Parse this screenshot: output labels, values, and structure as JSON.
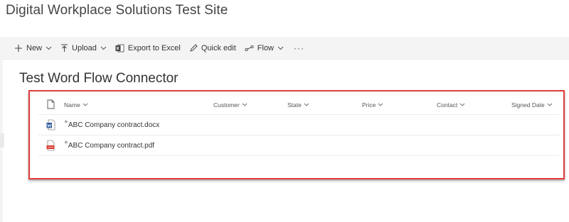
{
  "site": {
    "title": "Digital Workplace Solutions Test Site"
  },
  "commandbar": {
    "new_label": "New",
    "upload_label": "Upload",
    "export_label": "Export to Excel",
    "quickedit_label": "Quick edit",
    "flow_label": "Flow",
    "more_label": "···"
  },
  "list": {
    "title": "Test Word Flow Connector",
    "columns": {
      "name": "Name",
      "customer": "Customer",
      "state": "State",
      "price": "Price",
      "contact": "Contact",
      "signed_date": "Signed Date"
    },
    "rows": [
      {
        "name": "ABC Company contract.docx",
        "file_type": "word-doc-icon"
      },
      {
        "name": "ABC Company contract.pdf",
        "file_type": "pdf-file-icon"
      }
    ]
  },
  "colors": {
    "highlight": "#e03c3c",
    "word_blue": "#2b579a",
    "pdf_red": "#d9372b",
    "commandbar_bg": "#f4f4f4"
  }
}
